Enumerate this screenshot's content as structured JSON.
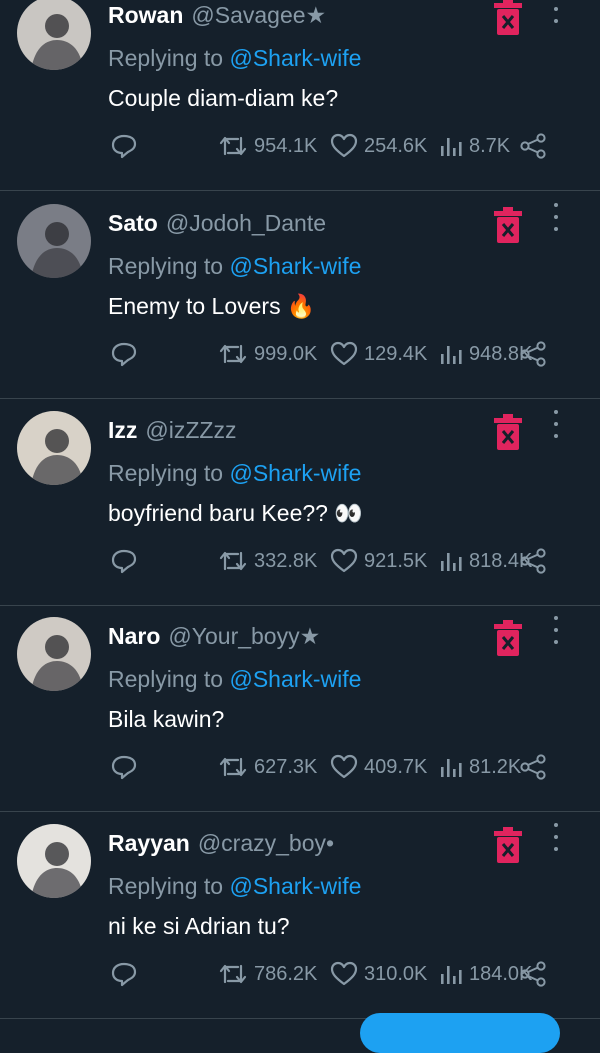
{
  "replies": [
    {
      "name": "Rowan",
      "handle": "@Savagee★",
      "replying_prefix": "Replying to",
      "replying_to": "@Shark-wife",
      "text": "Couple diam-diam ke?",
      "emoji": "",
      "retweets": "954.1K",
      "likes": "254.6K",
      "views": "8.7K",
      "avatar_color": "#c9c6c2"
    },
    {
      "name": "Sato",
      "handle": "@Jodoh_Dante",
      "replying_prefix": "Replying to",
      "replying_to": "@Shark-wife",
      "text": "Enemy to Lovers",
      "emoji": "🔥",
      "retweets": "999.0K",
      "likes": "129.4K",
      "views": "948.8K",
      "avatar_color": "#7a7d86"
    },
    {
      "name": "Izz",
      "handle": "@izZZzz",
      "replying_prefix": "Replying to",
      "replying_to": "@Shark-wife",
      "text": "boyfriend baru Kee??",
      "emoji": "👀",
      "retweets": "332.8K",
      "likes": "921.5K",
      "views": "818.4K",
      "avatar_color": "#d8d2c8"
    },
    {
      "name": "Naro",
      "handle": "@Your_boyy★",
      "replying_prefix": "Replying to",
      "replying_to": "@Shark-wife",
      "text": "Bila kawin?",
      "emoji": "",
      "retweets": "627.3K",
      "likes": "409.7K",
      "views": "81.2K",
      "avatar_color": "#cfcac4"
    },
    {
      "name": "Rayyan",
      "handle": "@crazy_boy•",
      "replying_prefix": "Replying to",
      "replying_to": "@Shark-wife",
      "text": "ni ke si Adrian tu?",
      "emoji": "",
      "retweets": "786.2K",
      "likes": "310.0K",
      "views": "184.0K",
      "avatar_color": "#e4e2de"
    }
  ],
  "colors": {
    "background": "#15202b",
    "divider": "#38444d",
    "secondary_text": "#8899a6",
    "mention": "#1da1f2",
    "delete_icon": "#e0245e",
    "fab": "#1da1f2"
  },
  "icons": [
    "avatar",
    "trash-icon",
    "more-vertical-icon",
    "comment-icon",
    "retweet-icon",
    "heart-icon",
    "views-bar-icon",
    "share-icon"
  ]
}
